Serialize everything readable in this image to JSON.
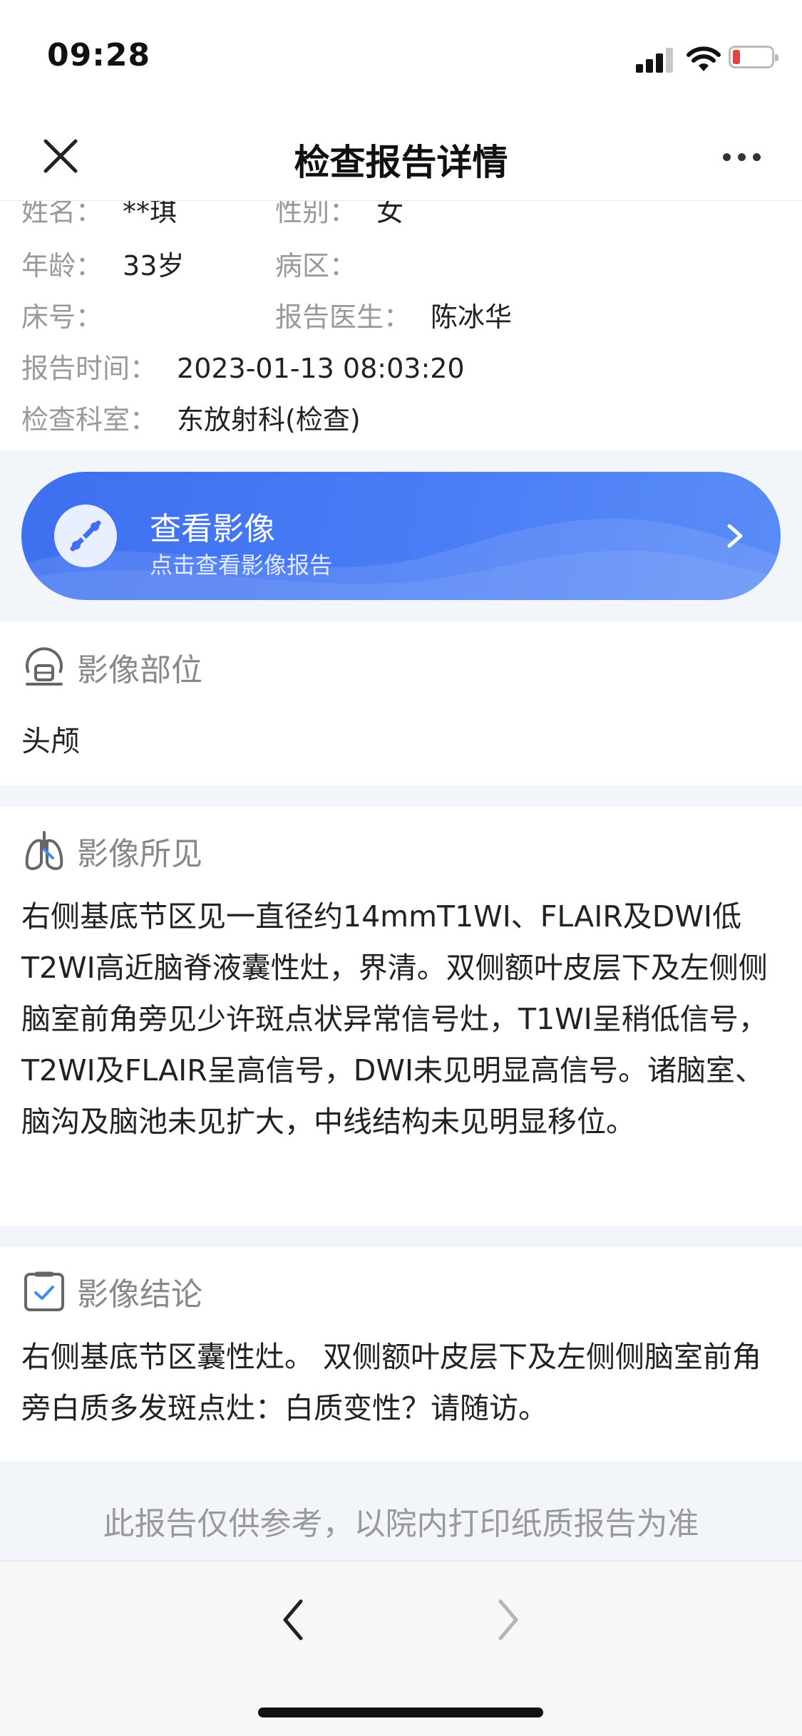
{
  "status_bar": {
    "time": "09:28"
  },
  "nav": {
    "title": "检查报告详情"
  },
  "info": {
    "name_label": "姓名：",
    "name_value": "**琪",
    "gender_label": "性别：",
    "gender_value": "女",
    "age_label": "年龄：",
    "age_value": "33岁",
    "ward_label": "病区：",
    "ward_value": "",
    "bed_label": "床号：",
    "bed_value": "",
    "doctor_label": "报告医生：",
    "doctor_value": "陈冰华",
    "time_label": "报告时间：",
    "time_value": "2023-01-13 08:03:20",
    "dept_label": "检查科室：",
    "dept_value": "东放射科(检查)"
  },
  "image_card": {
    "title": "查看影像",
    "subtitle": "点击查看影像报告",
    "accent_color": "#4a7df5"
  },
  "sections": {
    "part": {
      "title": "影像部位",
      "icon": "scanner-icon",
      "content": "头颅"
    },
    "findings": {
      "title": "影像所见",
      "icon": "lungs-icon",
      "content": "右侧基底节区见一直径约14mmT1WI、FLAIR及DWI低T2WI高近脑脊液囊性灶，界清。双侧额叶皮层下及左侧侧脑室前角旁见少许斑点状异常信号灶，T1WI呈稍低信号，T2WI及FLAIR呈高信号，DWI未见明显高信号。诸脑室、脑沟及脑池未见扩大，中线结构未见明显移位。"
    },
    "conclusion": {
      "title": "影像结论",
      "icon": "clipboard-check-icon",
      "content": "右侧基底节区囊性灶。 双侧额叶皮层下及左侧侧脑室前角旁白质多发斑点灶：白质变性？请随访。"
    }
  },
  "footer": {
    "note": "此报告仅供参考，以院内打印纸质报告为准"
  }
}
